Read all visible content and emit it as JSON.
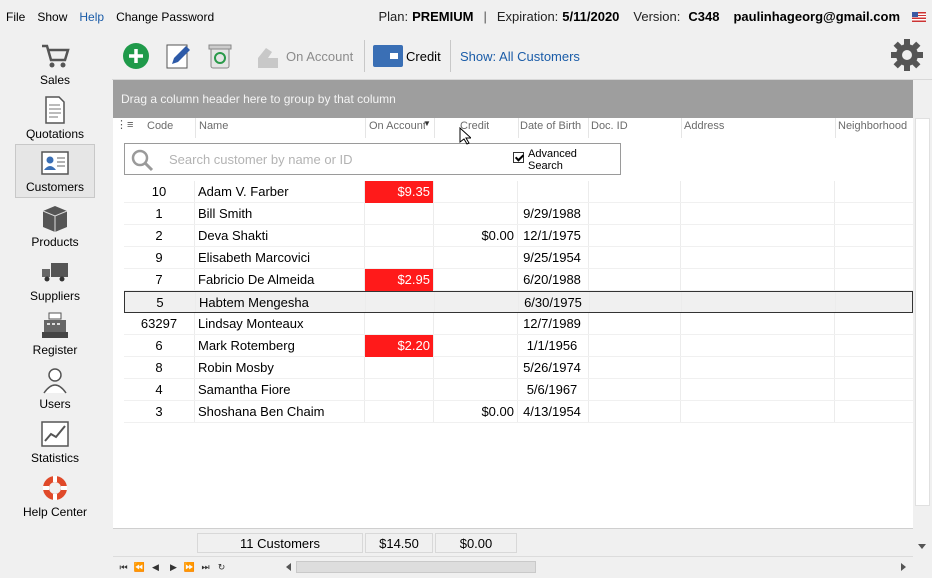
{
  "menu": {
    "items": [
      "File",
      "Show",
      "Help",
      "Change Password"
    ],
    "active_index": 2
  },
  "account": {
    "plan_label": "Plan:",
    "plan_value": "PREMIUM",
    "expiration_label": "Expiration:",
    "expiration_value": "5/11/2020",
    "version_label": "Version:",
    "version_value": "C348",
    "email": "paulinhageorg@gmail.com",
    "separator": "|"
  },
  "sidebar": {
    "items": [
      {
        "label": "Sales",
        "icon": "cart-icon"
      },
      {
        "label": "Quotations",
        "icon": "document-icon"
      },
      {
        "label": "Customers",
        "icon": "customers-icon"
      },
      {
        "label": "Products",
        "icon": "box-icon"
      },
      {
        "label": "Suppliers",
        "icon": "truck-icon"
      },
      {
        "label": "Register",
        "icon": "cash-register-icon"
      },
      {
        "label": "Users",
        "icon": "user-icon"
      },
      {
        "label": "Statistics",
        "icon": "chart-icon"
      },
      {
        "label": "Help Center",
        "icon": "lifebuoy-icon"
      }
    ],
    "active_index": 2
  },
  "toolbar": {
    "on_account_label": "On Account",
    "credit_label": "Credit",
    "show_label": "Show: All Customers"
  },
  "grid": {
    "group_hint": "Drag a column header here to group by that column",
    "columns": [
      "Code",
      "Name",
      "On Account",
      "Credit",
      "Date of Birth",
      "Doc. ID",
      "Address",
      "Neighborhood"
    ],
    "search_placeholder": "Search customer by name or ID",
    "advanced_search_line1": "Advanced",
    "advanced_search_line2": "Search",
    "advanced_search_checked": true,
    "rows": [
      {
        "code": "10",
        "name": "Adam V. Farber",
        "on_account": "$9.35",
        "credit": "",
        "dob": ""
      },
      {
        "code": "1",
        "name": "Bill Smith",
        "on_account": "",
        "credit": "",
        "dob": "9/29/1988"
      },
      {
        "code": "2",
        "name": "Deva Shakti",
        "on_account": "",
        "credit": "$0.00",
        "dob": "12/1/1975"
      },
      {
        "code": "9",
        "name": "Elisabeth Marcovici",
        "on_account": "",
        "credit": "",
        "dob": "9/25/1954"
      },
      {
        "code": "7",
        "name": "Fabricio De Almeida",
        "on_account": "$2.95",
        "credit": "",
        "dob": "6/20/1988"
      },
      {
        "code": "5",
        "name": "Habtem Mengesha",
        "on_account": "",
        "credit": "",
        "dob": "6/30/1975"
      },
      {
        "code": "63297",
        "name": "Lindsay Monteaux",
        "on_account": "",
        "credit": "",
        "dob": "12/7/1989"
      },
      {
        "code": "6",
        "name": "Mark Rotemberg",
        "on_account": "$2.20",
        "credit": "",
        "dob": "1/1/1956"
      },
      {
        "code": "8",
        "name": "Robin Mosby",
        "on_account": "",
        "credit": "",
        "dob": "5/26/1974"
      },
      {
        "code": "4",
        "name": "Samantha Fiore",
        "on_account": "",
        "credit": "",
        "dob": "5/6/1967"
      },
      {
        "code": "3",
        "name": "Shoshana Ben Chaim",
        "on_account": "",
        "credit": "$0.00",
        "dob": "4/13/1954"
      }
    ],
    "selected_row_index": 5,
    "highlight_color": "#ff1a1a"
  },
  "footer": {
    "count_label": "11 Customers",
    "on_account_total": "$14.50",
    "credit_total": "$0.00"
  },
  "navigator": [
    "⏮",
    "⏪",
    "◀",
    "▶",
    "⏩",
    "⏭",
    "↻"
  ]
}
